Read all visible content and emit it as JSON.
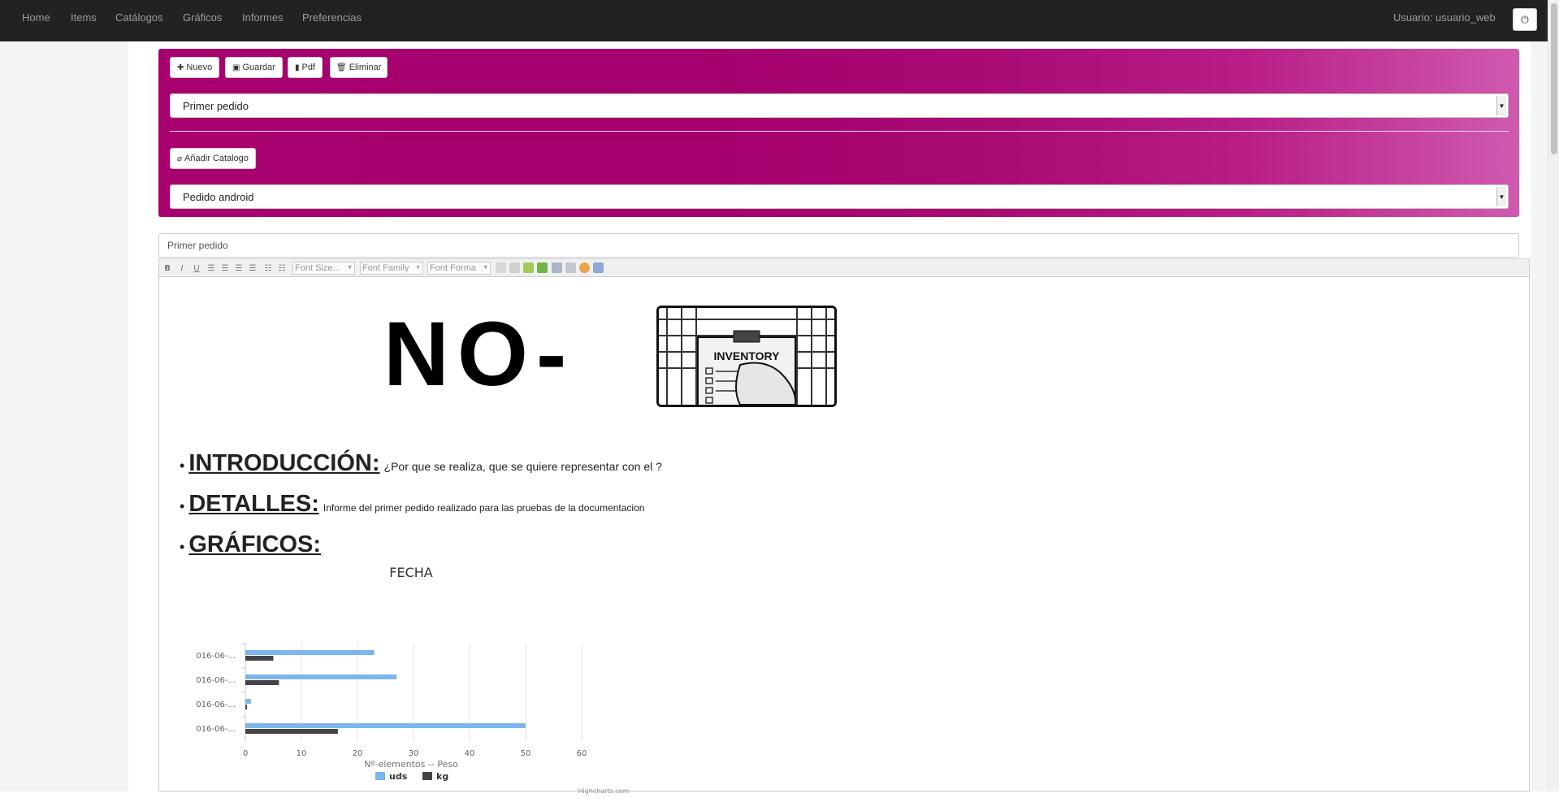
{
  "nav": {
    "items": [
      "Home",
      "Items",
      "Catálogos",
      "Gráficos",
      "Informes",
      "Preferencias"
    ],
    "user": "Usuario: usuario_web"
  },
  "panel": {
    "buttons": {
      "nuevo": "Nuevo",
      "guardar": "Guardar",
      "pdf": "Pdf",
      "eliminar": "Eliminar"
    },
    "report_select": "Primer pedido",
    "add_catalog": "Añadir Catalogo",
    "catalog_select": "Pedido android"
  },
  "title_input": "Primer pedido",
  "editor": {
    "toolbar": {
      "font_size": "Font Size...",
      "font_family": "Font Family",
      "font_format": "Font Forma"
    },
    "logo": {
      "text": "NO-",
      "image_label": "INVENTORY"
    },
    "sections": [
      {
        "heading": "INTRODUCCIÓN:",
        "body": "¿Por que se realiza, que se quiere representar con el ?"
      },
      {
        "heading": "DETALLES:",
        "body": "Informe del primer pedido realizado para las pruebas de la documentacion"
      },
      {
        "heading": "GRÁFICOS:",
        "body": ""
      }
    ]
  },
  "chart_data": {
    "type": "bar",
    "orientation": "horizontal",
    "title": "FECHA",
    "xlabel": "Nº-elementos -- Peso",
    "categories": [
      "016-06-...",
      "016-06-...",
      "016-06-...",
      "016-06-..."
    ],
    "series": [
      {
        "name": "uds",
        "color": "#7cb5ec",
        "values": [
          23,
          27,
          1,
          50
        ]
      },
      {
        "name": "kg",
        "color": "#434348",
        "values": [
          5,
          6,
          0.3,
          16.5
        ]
      }
    ],
    "xlim": [
      0,
      60
    ],
    "ticks": [
      0,
      10,
      20,
      30,
      40,
      50,
      60
    ],
    "credits": "Highcharts.com",
    "legend": "bottom-center"
  }
}
